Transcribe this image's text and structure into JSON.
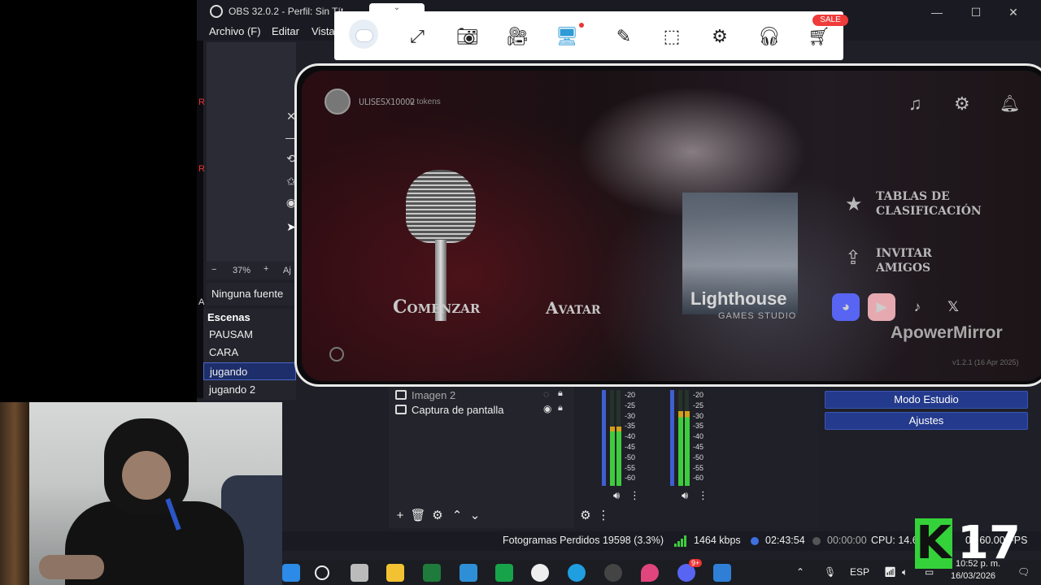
{
  "obs": {
    "title": "OBS 32.0.2 - Perfil: Sin Tít",
    "window_controls": {
      "minimize": "—",
      "maximize": "☐",
      "close": "✕"
    },
    "menu": [
      "Archivo (F)",
      "Editar",
      "Vista"
    ],
    "side_tools": [
      "close-icon",
      "minimize-icon",
      "rotate-icon",
      "pin-icon",
      "record-icon"
    ],
    "strip_marks": [
      "R",
      "R",
      "A"
    ],
    "zoom": {
      "minus": "−",
      "value": "37%",
      "plus": "+",
      "fit": "Aj"
    },
    "no_source": "Ninguna fuente",
    "scenes": {
      "title": "Escenas",
      "items": [
        "PAUSAM",
        "CARA",
        "jugando",
        "jugando 2"
      ],
      "active_index": 2
    },
    "sources": [
      {
        "label": "Imagen 2",
        "icon": "image-icon",
        "visible": false
      },
      {
        "label": "Captura de pantalla",
        "icon": "monitor-icon",
        "visible": true
      }
    ],
    "mixer": {
      "scale": [
        "-20",
        "-25",
        "-30",
        "-35",
        "-40",
        "-45",
        "-50",
        "-55",
        "-60"
      ],
      "channels": [
        {
          "level": 0.62,
          "peak_color": "#d4a017"
        },
        {
          "level": 0.78,
          "peak_color": "#d4a017"
        }
      ]
    },
    "controls": [
      "Modo Estudio",
      "Ajustes"
    ],
    "status": {
      "dropped": "Fotogramas Perdidos 19598 (3.3%)",
      "bitrate": "1464 kbps",
      "live_time": "02:43:54",
      "rec_time": "00:00:00",
      "cpu": "CPU: 14.6",
      "fps": "0 / 60.00 FPS"
    },
    "colors": {
      "live": "#3f6fe0",
      "rec": "#555555",
      "signal": "#3ecc3e"
    }
  },
  "mirror_toolbar": {
    "drag_tab": "⌄",
    "buttons": [
      "expand-icon",
      "camera-icon",
      "video-record-icon",
      "cast-icon",
      "brush-icon",
      "select-region-icon",
      "settings-icon",
      "support-icon",
      "cart-icon"
    ],
    "sale_badge": "SALE"
  },
  "phone": {
    "user_name": "ULISESX10002",
    "tokens": "0 tokens",
    "top_icons": [
      "music-icon",
      "gear-icon",
      "bell-icon"
    ],
    "menu": [
      "Comenzar",
      "Avatar"
    ],
    "lighthouse_title": "Lighthouse",
    "lighthouse_sub": "GAMES STUDIO",
    "leaderboards": "TABLAS DE\nCLASIFICACIÓN",
    "invite": "INVITAR\nAMIGOS",
    "social": [
      "discord-icon",
      "youtube-icon",
      "tiktok-icon",
      "x-icon"
    ],
    "watermark": "ApowerMirror",
    "version": "v1.2.1 (16 Apr 2025)"
  },
  "taskbar": {
    "lang": "ESP",
    "time": "10:52 p. m.",
    "date": "16/03/2026",
    "badge": "9+"
  },
  "overlay": {
    "letter": "K",
    "number": "17"
  }
}
